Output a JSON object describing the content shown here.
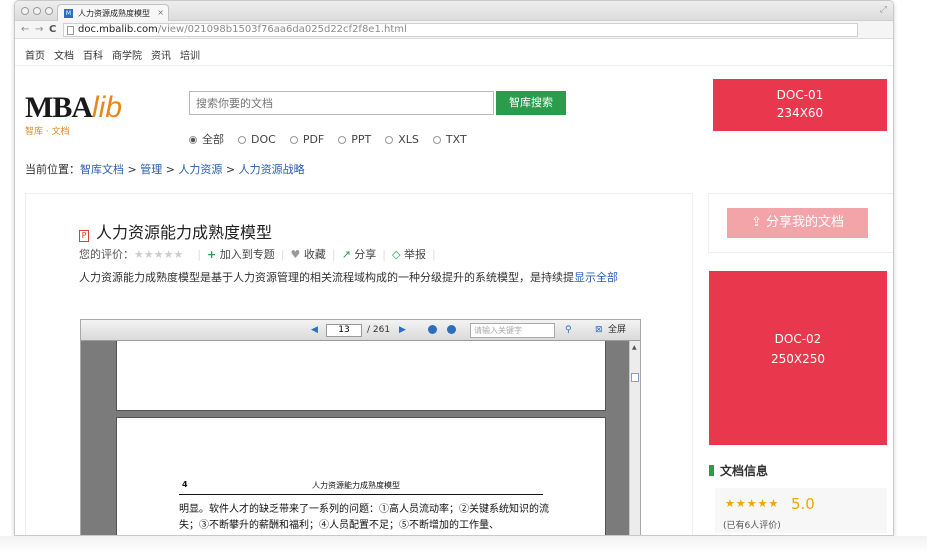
{
  "browser": {
    "tab_title": "人力资源成熟度模型",
    "tab_close": "×",
    "tab_favicon": "M",
    "url_host": "doc.mbalib.com",
    "url_path": "/view/021098b1503f76aa6da025d22cf2f8e1.html",
    "nav_back": "←",
    "nav_forward": "→",
    "nav_reload": "C"
  },
  "topnav": [
    "首页",
    "文档",
    "百科",
    "商学院",
    "资讯",
    "培训"
  ],
  "logo": {
    "main": "MBA",
    "lib": "lib",
    "sub": "智库 · 文档"
  },
  "search": {
    "placeholder": "搜索你要的文档",
    "button": "智库搜索"
  },
  "filetypes": [
    {
      "label": "全部",
      "checked": true
    },
    {
      "label": "DOC",
      "checked": false
    },
    {
      "label": "PDF",
      "checked": false
    },
    {
      "label": "PPT",
      "checked": false
    },
    {
      "label": "XLS",
      "checked": false
    },
    {
      "label": "TXT",
      "checked": false
    }
  ],
  "breadcrumb": {
    "prefix": "当前位置：",
    "items": [
      "智库文档",
      "管理",
      "人力资源",
      "人力资源战略"
    ],
    "sep": " > "
  },
  "doc": {
    "file_icon": "P",
    "title": "人力资源能力成熟度模型",
    "rating_label": "您的评价：",
    "stars": "★★★★★",
    "actions": {
      "add": "加入到专题",
      "favorite": "收藏",
      "share": "分享",
      "report": "举报"
    },
    "description": "人力资源能力成熟度模型是基于人力资源管理的相关流程域构成的一种分级提升的系统模型，是持续提",
    "show_all": "显示全部"
  },
  "viewer": {
    "current_page": "13",
    "total_pages": "/ 261",
    "keyword_placeholder": "请输入关键字",
    "fullscreen": "全屏",
    "page_number": "4",
    "page_header": "人力资源能力成熟度模型",
    "page_text": "明显。软件人才的缺乏带来了一系列的问题：①高人员流动率；②关键系统知识的流失；③不断攀升的薪酬和福利；④人员配置不足；⑤不断增加的工作量、"
  },
  "sidebar": {
    "ad1": {
      "line1": "DOC-01",
      "line2": "234X60"
    },
    "share_button": "分享我的文档",
    "ad2": {
      "line1": "DOC-02",
      "line2": "250X250"
    },
    "docinfo_title": "文档信息",
    "rating_stars": "★★★★★",
    "rating_score": "5.0",
    "rating_count": "(已有6人评价)"
  },
  "colors": {
    "brand_green": "#2a9c4b",
    "ad_red": "#e9384d",
    "share_pink": "#f2a4a8",
    "link_blue": "#2a5db0",
    "logo_orange": "#e8861c",
    "star_gold": "#f0a500"
  }
}
